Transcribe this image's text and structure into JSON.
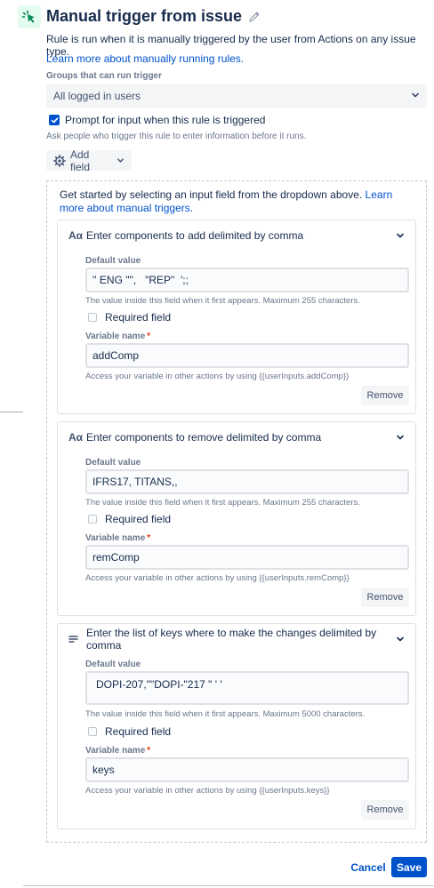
{
  "header": {
    "title": "Manual trigger from issue",
    "description": "Rule is run when it is manually triggered by the user from Actions on any issue type.",
    "learn_link": "Learn more about manually running rules."
  },
  "groups": {
    "label": "Groups that can run trigger",
    "selected": "All logged in users"
  },
  "prompt": {
    "label": "Prompt for input when this rule is triggered",
    "checked": true,
    "helper": "Ask people who trigger this rule to enter information before it runs."
  },
  "add_field": {
    "label": "Add field"
  },
  "dropzone": {
    "intro_text": "Get started by selecting an input field from the dropdown above.",
    "intro_link": "Learn more about manual triggers."
  },
  "cards": [
    {
      "icon": "text-field-icon",
      "icon_text": "Aα",
      "title": "Enter components to add delimited by comma",
      "default_label": "Default value",
      "default_value": "'' ENG \"\",   \"REP\"  ';;",
      "default_helper": "The value inside this field when it first appears. Maximum 255 characters.",
      "required_label": "Required field",
      "variable_label": "Variable name",
      "variable_value": "addComp",
      "variable_helper": "Access your variable in other actions by using {{userInputs.addComp}}",
      "remove_label": "Remove"
    },
    {
      "icon": "text-field-icon",
      "icon_text": "Aα",
      "title": "Enter components to remove delimited by comma",
      "default_label": "Default value",
      "default_value": "IFRS17, TITANS,,",
      "default_helper": "The value inside this field when it first appears. Maximum 255 characters.",
      "required_label": "Required field",
      "variable_label": "Variable name",
      "variable_value": "remComp",
      "variable_helper": "Access your variable in other actions by using {{userInputs.remComp}}",
      "remove_label": "Remove"
    },
    {
      "icon": "paragraph-field-icon",
      "title": "Enter the list of keys where to make the changes delimited by comma",
      "default_label": "Default value",
      "default_value": "DOPI-207,\"\"DOPI-\"217 \" ' '",
      "default_helper": "The value inside this field when it first appears. Maximum 5000 characters.",
      "required_label": "Required field",
      "variable_label": "Variable name",
      "variable_value": "keys",
      "variable_helper": "Access your variable in other actions by using {{userInputs.keys}}",
      "remove_label": "Remove"
    }
  ],
  "footer": {
    "cancel_label": "Cancel",
    "save_label": "Save"
  },
  "colors": {
    "accent": "#0052cc",
    "trigger_icon_bg": "#e3fcef",
    "trigger_icon_fg": "#00875a",
    "required_star": "#de350b"
  }
}
